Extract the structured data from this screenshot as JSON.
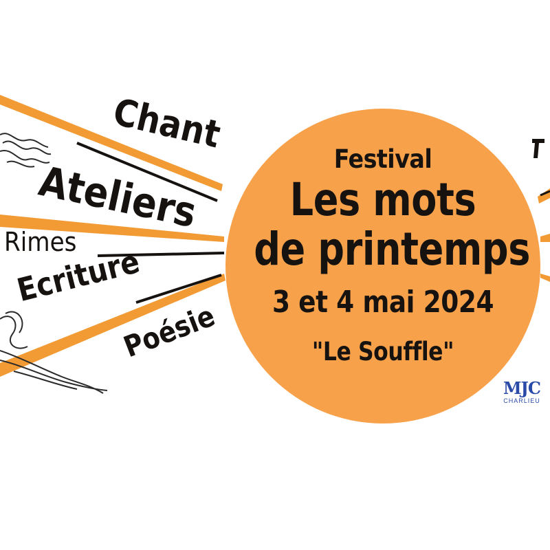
{
  "poster": {
    "festival_label": "Festival",
    "title_line1": "Les mots",
    "title_line2": "de printemps",
    "dates": "3 et 4 mai 2024",
    "venue": "\"Le Souffle\""
  },
  "activities": [
    "Chant",
    "Ateliers",
    "Rimes",
    "Ecriture",
    "Poésie"
  ],
  "logo": {
    "mark": "MJC",
    "subtitle": "CHARLIEU"
  },
  "colors": {
    "sun": "#f7a24b",
    "ray_orange": "#f29a33",
    "ink": "#161210",
    "logo_blue": "#2a4aa8"
  },
  "icons": [
    "smoke-swirl-icon",
    "mjc-logo-icon"
  ]
}
